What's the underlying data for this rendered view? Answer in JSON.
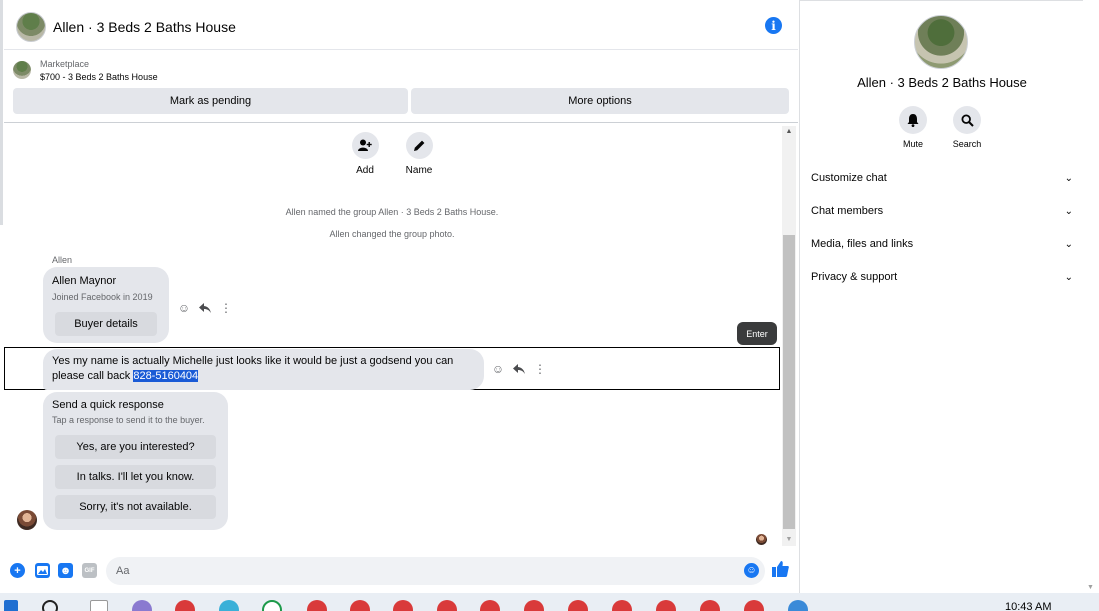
{
  "chat": {
    "title": "Allen · 3 Beds 2 Baths House",
    "marketplace_label": "Marketplace",
    "marketplace_item": "$700 - 3 Beds 2 Baths House",
    "buttons": {
      "mark_pending": "Mark as pending",
      "more_options": "More options"
    },
    "actions": [
      {
        "label": "Add",
        "icon": "add-person-icon"
      },
      {
        "label": "Name",
        "icon": "pencil-icon"
      }
    ],
    "system_messages": [
      "Allen named the group Allen · 3 Beds 2 Baths House.",
      "Allen changed the group photo."
    ],
    "sender": "Allen",
    "profile_card": {
      "name": "Allen Maynor",
      "subtitle": "Joined Facebook in 2019",
      "button": "Buyer details"
    },
    "message": {
      "text_before": "Yes my name is actually Michelle just looks like it would be just a godsend you can please call back ",
      "text_highlighted": "828-5160404"
    },
    "tooltip": "Enter",
    "quick_response": {
      "title": "Send a quick response",
      "subtitle": "Tap a response to send it to the buyer.",
      "options": [
        "Yes, are you interested?",
        "In talks. I'll let you know.",
        "Sorry, it's not available."
      ]
    },
    "composer": {
      "placeholder": "Aa",
      "gif_label": "GIF"
    }
  },
  "panel": {
    "title": "Allen · 3 Beds 2 Baths House",
    "actions": [
      {
        "label": "Mute",
        "icon": "bell-icon"
      },
      {
        "label": "Search",
        "icon": "search-icon"
      }
    ],
    "sections": [
      "Customize chat",
      "Chat members",
      "Media, files and links",
      "Privacy & support"
    ]
  },
  "taskbar": {
    "clock": "10:43 AM"
  },
  "colors": {
    "accent": "#1877f2",
    "bubble": "#e4e6eb",
    "highlight": "#1a5bd6"
  }
}
